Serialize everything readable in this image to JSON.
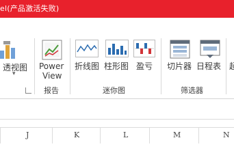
{
  "window": {
    "title": "el(产品激活失败)"
  },
  "ribbon": {
    "pivot_chart": {
      "label": "透视图",
      "dropdown": "▾"
    },
    "report_group": {
      "label": "报告",
      "power_view": {
        "line1": "Power",
        "line2": "View"
      }
    },
    "sparkline_group": {
      "label": "迷你图",
      "line": "折线图",
      "column": "柱形图",
      "winloss": "盈亏"
    },
    "filter_group": {
      "label": "筛选器",
      "slicer": "切片器",
      "timeline": "日程表"
    },
    "next_partial": "超"
  },
  "columns": [
    "J",
    "K",
    "L",
    "M",
    "N"
  ],
  "colors": {
    "titlebar": "#e8212c",
    "accent_blue": "#2b6cb0",
    "accent_red": "#d13438"
  }
}
